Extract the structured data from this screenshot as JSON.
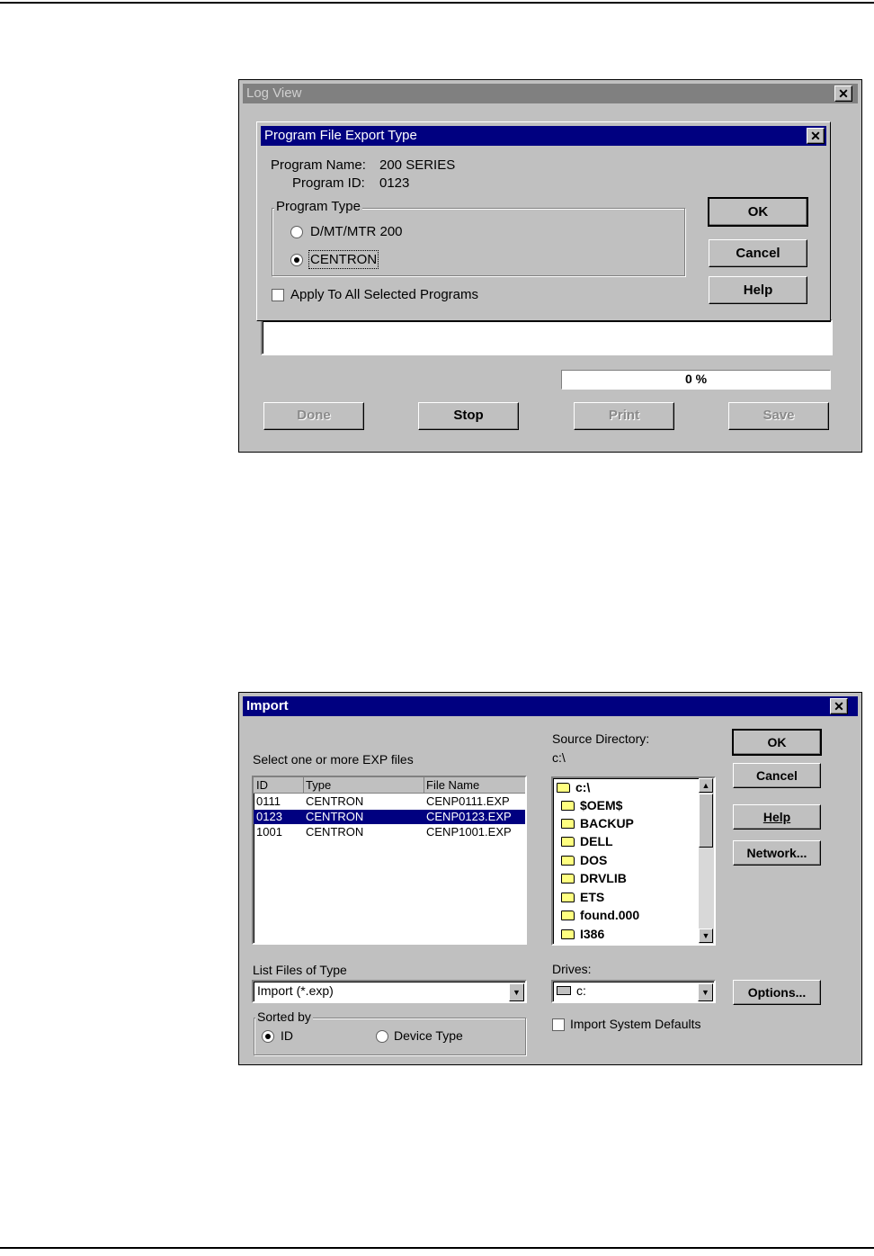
{
  "log_view": {
    "title": "Log View",
    "close": "✕",
    "progress_text": "0 %",
    "buttons": {
      "done": "Done",
      "stop": "Stop",
      "print": "Print",
      "save": "Save"
    }
  },
  "export_dialog": {
    "title": "Program File Export Type",
    "close": "✕",
    "program_name_label": "Program Name:",
    "program_name_value": "200 SERIES",
    "program_id_label": "Program ID:",
    "program_id_value": "0123",
    "program_type_label": "Program Type",
    "options": [
      {
        "label": "D/MT/MTR 200",
        "selected": false
      },
      {
        "label": "CENTRON",
        "selected": true
      }
    ],
    "apply_all_label": "Apply To All Selected Programs",
    "buttons": {
      "ok": "OK",
      "cancel": "Cancel",
      "help": "Help"
    }
  },
  "import_dialog": {
    "title": "Import",
    "close": "✕",
    "select_label": "Select one or more EXP files",
    "columns": {
      "id": "ID",
      "type": "Type",
      "file": "File Name"
    },
    "rows": [
      {
        "id": "0111",
        "type": "CENTRON",
        "file": "CENP0111.EXP",
        "selected": false
      },
      {
        "id": "0123",
        "type": "CENTRON",
        "file": "CENP0123.EXP",
        "selected": true
      },
      {
        "id": "1001",
        "type": "CENTRON",
        "file": "CENP1001.EXP",
        "selected": false
      }
    ],
    "source_dir_label": "Source Directory:",
    "source_dir_value": "c:\\",
    "dirs": [
      "c:\\",
      "$OEM$",
      "BACKUP",
      "DELL",
      "DOS",
      "DRVLIB",
      "ETS",
      "found.000",
      "I386"
    ],
    "list_type_label": "List Files of Type",
    "list_type_value": "Import (*.exp)",
    "drives_label": "Drives:",
    "drives_value": "c:",
    "sorted_by_label": "Sorted by",
    "sort_id": "ID",
    "sort_device": "Device Type",
    "import_defaults_label": "Import System Defaults",
    "buttons": {
      "ok": "OK",
      "cancel": "Cancel",
      "help": "Help",
      "network": "Network...",
      "options": "Options..."
    }
  },
  "colors": {
    "active_title": "#000080",
    "inactive_title": "#808080",
    "face": "#c0c0c0"
  }
}
